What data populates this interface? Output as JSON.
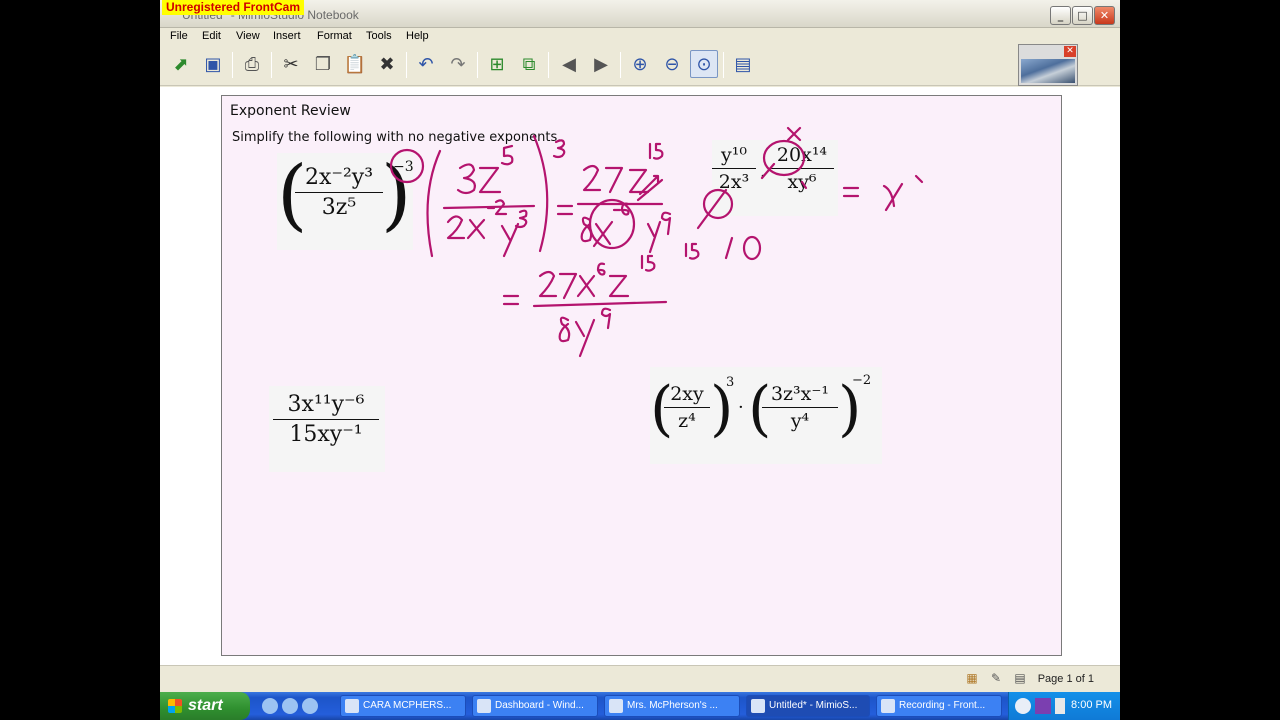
{
  "app": {
    "watermark": "Unregistered FrontCam",
    "window_title": "Untitled* - MimioStudio Notebook",
    "window_buttons": [
      "minimize-icon",
      "maximize-icon",
      "close-icon"
    ]
  },
  "menu": [
    "File",
    "Edit",
    "View",
    "Insert",
    "Format",
    "Tools",
    "Help"
  ],
  "toolbar": {
    "icons": [
      "open-icon",
      "save-icon",
      "print-icon",
      "cut-icon",
      "copy-icon",
      "paste-icon",
      "delete-icon",
      "undo-icon",
      "redo-icon",
      "new-page-icon",
      "duplicate-page-icon",
      "previous-page-icon",
      "next-page-icon",
      "zoom-in-icon",
      "zoom-out-icon",
      "zoom-fit-icon",
      "screen-icon"
    ]
  },
  "page": {
    "title": "Exponent Review",
    "instruction": "Simplify the following with no negative exponents."
  },
  "problems": {
    "p1": {
      "num": "2x⁻²y³",
      "den": "3z⁵",
      "outer_exp": "−3"
    },
    "p2": {
      "left_num": "y¹⁰",
      "left_den": "2x³",
      "right_num": "20x¹⁴",
      "right_den": "xy⁶"
    },
    "p3": {
      "num": "3x¹¹y⁻⁶",
      "den": "15xy⁻¹"
    },
    "p4": {
      "a_num": "2xy",
      "a_den": "z⁴",
      "a_exp": "3",
      "b_num": "3z³x⁻¹",
      "b_den": "y⁴",
      "b_exp": "−2"
    }
  },
  "status": {
    "page_count": "Page 1 of 1"
  },
  "taskbar": {
    "start_label": "start",
    "tasks": [
      "CARA MCPHERS...",
      "Dashboard - Wind...",
      "Mrs. McPherson's ...",
      "Untitled* - MimioS...",
      "Recording - Front..."
    ],
    "clock": "8:00 PM"
  },
  "colors": {
    "ink": "#b4146e",
    "page_bg": "#fbf0fa",
    "watermark_bg": "#ffff00",
    "watermark_text": "#d00000"
  }
}
